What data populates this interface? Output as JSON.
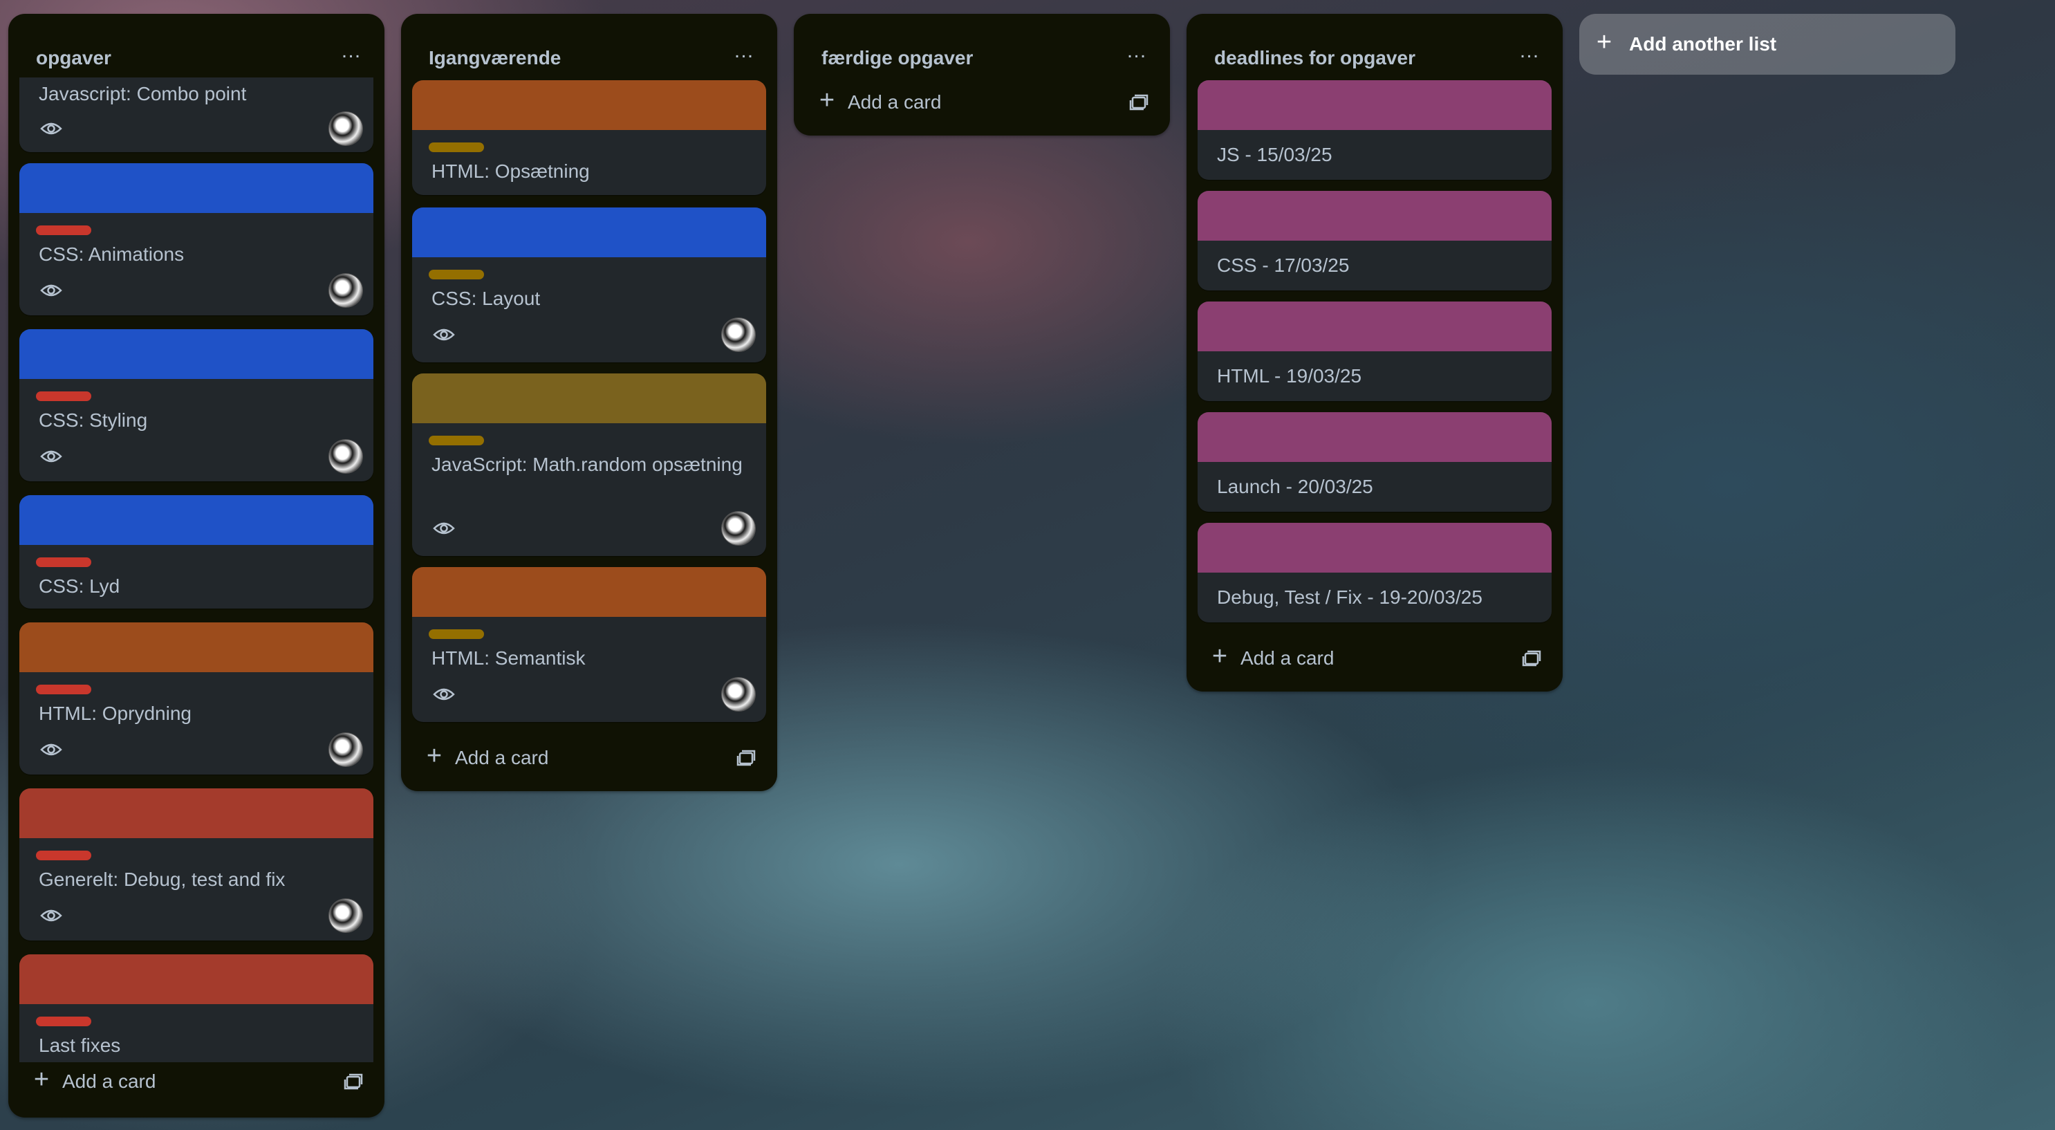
{
  "colors": {
    "list_bg": "#101204",
    "card_bg": "#22272b",
    "text": "#b6c2cf",
    "cover_blue": "#1f52c7",
    "cover_orange": "#9c4c1c",
    "cover_olive": "#7a621e",
    "cover_red": "#a43b2c",
    "cover_magenta": "#8b3f71",
    "label_red": "#c9372c",
    "label_olive": "#946f00"
  },
  "icons": {
    "menu": "…",
    "plus": "+",
    "watch": "eye-icon",
    "template": "card-template-icon",
    "member": "avatar"
  },
  "lists": [
    {
      "title": "opgaver",
      "add_label": "Add a card",
      "cards": [
        {
          "title": "Javascript: Combo point"
        },
        {
          "title": "CSS: Animations"
        },
        {
          "title": "CSS: Styling"
        },
        {
          "title": "CSS: Lyd"
        },
        {
          "title": "HTML: Oprydning"
        },
        {
          "title": "Generelt: Debug, test and fix"
        },
        {
          "title": "Last fixes"
        }
      ]
    },
    {
      "title": "Igangværende",
      "add_label": "Add a card",
      "cards": [
        {
          "title": "HTML: Opsætning"
        },
        {
          "title": "CSS: Layout"
        },
        {
          "title": "JavaScript: Math.random opsætning"
        },
        {
          "title": "HTML: Semantisk"
        }
      ]
    },
    {
      "title": "færdige opgaver",
      "add_label": "Add a card",
      "cards": []
    },
    {
      "title": "deadlines for opgaver",
      "add_label": "Add a card",
      "cards": [
        {
          "title": "JS - 15/03/25"
        },
        {
          "title": "CSS - 17/03/25"
        },
        {
          "title": "HTML - 19/03/25"
        },
        {
          "title": "Launch - 20/03/25"
        },
        {
          "title": "Debug, Test / Fix - 19-20/03/25"
        }
      ]
    }
  ],
  "add_list_label": "Add another list"
}
